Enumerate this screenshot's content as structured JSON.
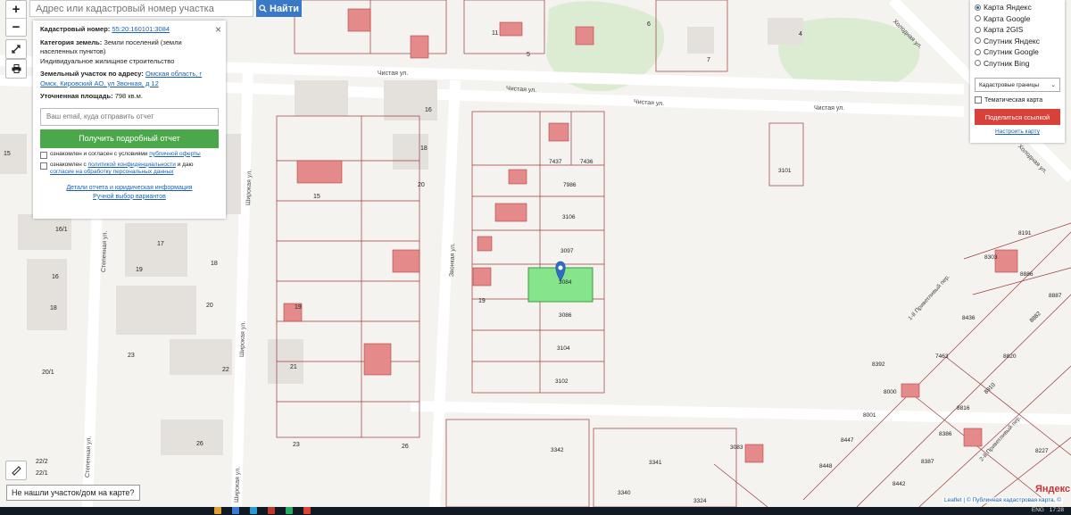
{
  "search": {
    "placeholder": "Адрес или кадастровый номер участка",
    "button_label": "Найти"
  },
  "zoom": {
    "in": "+",
    "out": "−"
  },
  "info": {
    "cadastral_label": "Кадастровый номер:",
    "cadastral_value": "55:20:160101:3084",
    "category_label": "Категория земель:",
    "category_value": "Земли поселений (земли населенных пунктов)",
    "usage_value": "Индивидуальное жилищное строительство",
    "address_label": "Земельный участок по адресу:",
    "address_value": "Омская область, г Омск, Кировский АО, ул Звонкая, д 12",
    "area_label": "Уточненная площадь:",
    "area_value": "798 кв.м.",
    "email_placeholder": "Ваш email, куда отправить отчет",
    "get_report": "Получить подробный отчет",
    "agree1_prefix": "ознакомлен и согласен с условиями",
    "agree1_link": "публичной оферты",
    "agree2_prefix": "ознакомлен с",
    "agree2_link1": "политикой конфиденциальности",
    "agree2_mid": "и даю",
    "agree2_link2": "согласие на обработку персональных данных",
    "details_link": "Детали отчета и юридическая информация",
    "manual_link": "Ручной выбор вариантов",
    "close": "×"
  },
  "layers": {
    "options": [
      "Карта Яндекс",
      "Карта Google",
      "Карта 2GIS",
      "Спутник Яндекс",
      "Спутник Google",
      "Спутник Bing"
    ],
    "selected": 0,
    "select_value": "Кадастровые границы",
    "thematic": "Тематическая карта",
    "share": "Поделиться ссылкой",
    "configure": "Настроить карту"
  },
  "not_found": "Не нашли участок/дом на карте?",
  "attribution": {
    "leaflet": "Leaflet",
    "sep": " | ",
    "rest": "© Публичная кадастровая карта, ©"
  },
  "yandex_logo": "Яндекс",
  "map": {
    "streets": [
      {
        "name": "Чистая ул.",
        "id": "s1"
      },
      {
        "name": "Чистая ул.",
        "id": "s2"
      },
      {
        "name": "Чистая ул.",
        "id": "s3"
      },
      {
        "name": "Чистая ул.",
        "id": "s4"
      },
      {
        "name": "Широкая ул.",
        "id": "s5"
      },
      {
        "name": "Широкая ул.",
        "id": "s6"
      },
      {
        "name": "Широкая ул.",
        "id": "s7"
      },
      {
        "name": "Звонкая ул.",
        "id": "s8"
      },
      {
        "name": "Степенная ул.",
        "id": "s9"
      },
      {
        "name": "Степенная ул.",
        "id": "s10"
      },
      {
        "name": "Холодная ул.",
        "id": "s11"
      },
      {
        "name": "Холодная ул.",
        "id": "s12"
      },
      {
        "name": "1-й Приветливый пер.",
        "id": "s13"
      },
      {
        "name": "2-й Приветливый пер.",
        "id": "s14"
      }
    ],
    "house_numbers": [
      "11",
      "6",
      "4",
      "7",
      "5",
      "16",
      "18",
      "20",
      "15",
      "16/1",
      "17",
      "19",
      "18",
      "16",
      "18",
      "20",
      "19",
      "23",
      "22",
      "21",
      "26",
      "23",
      "26",
      "22/2",
      "22/1",
      "20/1",
      "15",
      "19"
    ],
    "parcels": [
      "7437",
      "7436",
      "7986",
      "3106",
      "3097",
      "3084",
      "3086",
      "3104",
      "3102",
      "3101",
      "3342",
      "3341",
      "3340",
      "3083",
      "3324",
      "8191",
      "8303",
      "8886",
      "8887",
      "8436",
      "8392",
      "7463",
      "8000",
      "8001",
      "8820",
      "8816",
      "8386",
      "8387",
      "8447",
      "8448",
      "8442",
      "8227",
      "8910",
      "8882"
    ]
  },
  "taskbar": {
    "lang": "ENG",
    "time": "17:28"
  }
}
